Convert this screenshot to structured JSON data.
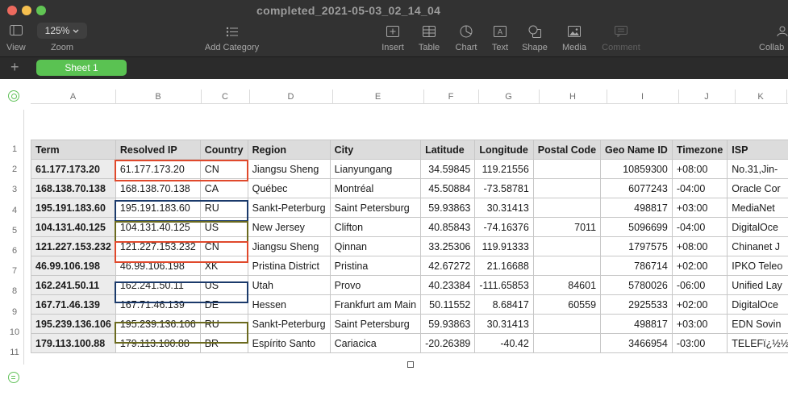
{
  "window": {
    "title": "completed_2021-05-03_02_14_04"
  },
  "toolbar": {
    "view_label": "View",
    "zoom_value": "125%",
    "zoom_label": "Zoom",
    "add_category_label": "Add Category",
    "insert_label": "Insert",
    "table_label": "Table",
    "chart_label": "Chart",
    "text_label": "Text",
    "shape_label": "Shape",
    "media_label": "Media",
    "comment_label": "Comment",
    "collab_label": "Collab"
  },
  "sheets": {
    "active": "Sheet 1"
  },
  "columns": [
    "A",
    "B",
    "C",
    "D",
    "E",
    "F",
    "G",
    "H",
    "I",
    "J",
    "K"
  ],
  "row_numbers": [
    "1",
    "2",
    "3",
    "4",
    "5",
    "6",
    "7",
    "8",
    "9",
    "10",
    "11"
  ],
  "table": {
    "headers": [
      "Term",
      "Resolved IP",
      "Country",
      "Region",
      "City",
      "Latitude",
      "Longitude",
      "Postal Code",
      "Geo Name ID",
      "Timezone",
      "ISP"
    ],
    "rows": [
      [
        "61.177.173.20",
        "61.177.173.20",
        "CN",
        "Jiangsu Sheng",
        "Lianyungang",
        "34.59845",
        "119.21556",
        "",
        "10859300",
        "+08:00",
        "No.31,Jin-"
      ],
      [
        "168.138.70.138",
        "168.138.70.138",
        "CA",
        "Québec",
        "Montréal",
        "45.50884",
        "-73.58781",
        "",
        "6077243",
        "-04:00",
        "Oracle Cor"
      ],
      [
        "195.191.183.60",
        "195.191.183.60",
        "RU",
        "Sankt-Peterburg",
        "Saint Petersburg",
        "59.93863",
        "30.31413",
        "",
        "498817",
        "+03:00",
        "MediaNet"
      ],
      [
        "104.131.40.125",
        "104.131.40.125",
        "US",
        "New Jersey",
        "Clifton",
        "40.85843",
        "-74.16376",
        "7011",
        "5096699",
        "-04:00",
        "DigitalOce"
      ],
      [
        "121.227.153.232",
        "121.227.153.232",
        "CN",
        "Jiangsu Sheng",
        "Qinnan",
        "33.25306",
        "119.91333",
        "",
        "1797575",
        "+08:00",
        "Chinanet J"
      ],
      [
        "46.99.106.198",
        "46.99.106.198",
        "XK",
        "Pristina District",
        "Pristina",
        "42.67272",
        "21.16688",
        "",
        "786714",
        "+02:00",
        "IPKO Teleo"
      ],
      [
        "162.241.50.11",
        "162.241.50.11",
        "US",
        "Utah",
        "Provo",
        "40.23384",
        "-111.65853",
        "84601",
        "5780026",
        "-06:00",
        "Unified Lay"
      ],
      [
        "167.71.46.139",
        "167.71.46.139",
        "DE",
        "Hessen",
        "Frankfurt am Main",
        "50.11552",
        "8.68417",
        "60559",
        "2925533",
        "+02:00",
        "DigitalOce"
      ],
      [
        "195.239.136.106",
        "195.239.136.106",
        "RU",
        "Sankt-Peterburg",
        "Saint Petersburg",
        "59.93863",
        "30.31413",
        "",
        "498817",
        "+03:00",
        "EDN Sovin"
      ],
      [
        "179.113.100.88",
        "179.113.100.88",
        "BR",
        "Espírito Santo",
        "Cariacica",
        "-20.26389",
        "-40.42",
        "",
        "3466954",
        "-03:00",
        "TELEFï¿½½"
      ]
    ]
  },
  "highlight_colors": {
    "red": "#e0492c",
    "navy": "#1b3a6b",
    "olive": "#6b6a1e"
  }
}
